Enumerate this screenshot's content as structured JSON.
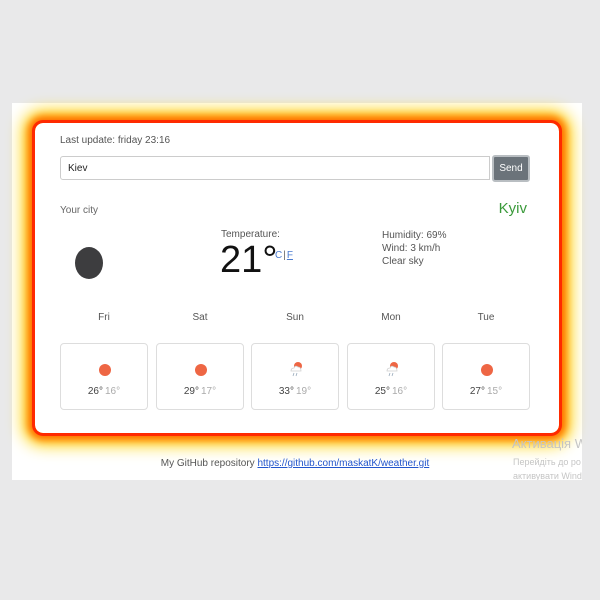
{
  "header": {
    "last_update": "Last update: friday 23:16"
  },
  "search": {
    "value": "Kiev",
    "send_label": "Send"
  },
  "city": {
    "label": "Your city",
    "name": "Kyiv"
  },
  "current": {
    "icon": "dark-circle-icon",
    "temperature_label": "Temperature:",
    "temperature": "21°",
    "unit_c": "C",
    "unit_sep": "|",
    "unit_f": "F",
    "humidity": "Humidity: 69%",
    "wind": "Wind: 3 km/h",
    "description": "Clear sky"
  },
  "forecast": [
    {
      "day": "Fri",
      "max": "26°",
      "min": "16°",
      "icon": "sun-icon"
    },
    {
      "day": "Sat",
      "max": "29°",
      "min": "17°",
      "icon": "sun-icon"
    },
    {
      "day": "Sun",
      "max": "33°",
      "min": "19°",
      "icon": "partly-cloudy-icon"
    },
    {
      "day": "Mon",
      "max": "25°",
      "min": "16°",
      "icon": "partly-cloudy-icon"
    },
    {
      "day": "Tue",
      "max": "27°",
      "min": "15°",
      "icon": "sun-icon"
    }
  ],
  "footer": {
    "text": "My GitHub repository",
    "link": "https://github.com/maskatK/weather.git"
  },
  "watermark": {
    "title": "Активація W",
    "line1": "Перейдіть до ро",
    "line2": "активувати Wind"
  },
  "colors": {
    "city": "#3a9a3a",
    "sun": "#ee6644",
    "send_button": "#6b737a",
    "link": "#2255cc"
  }
}
